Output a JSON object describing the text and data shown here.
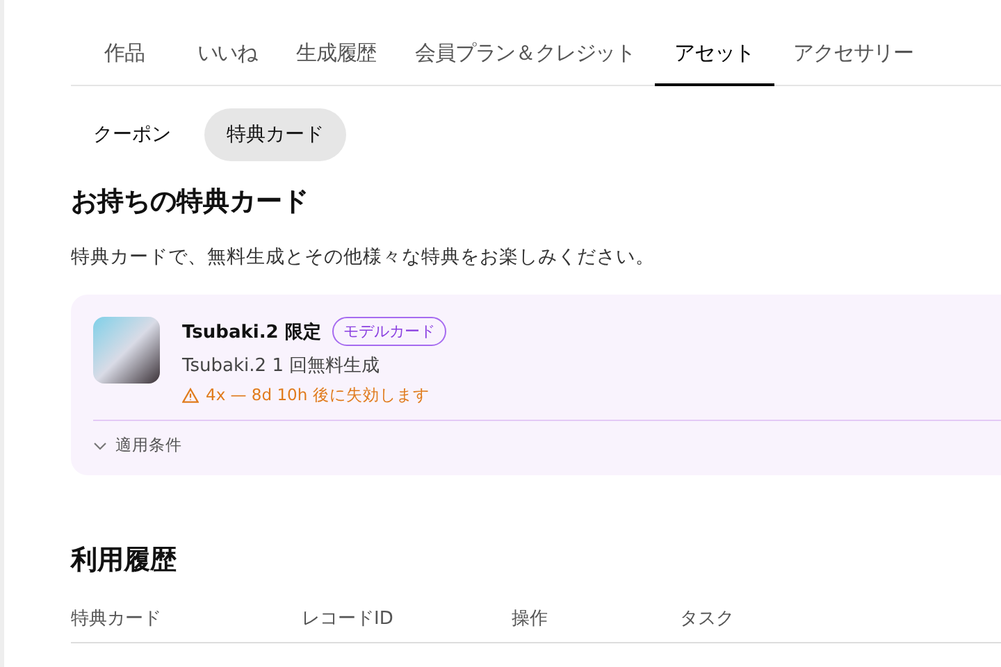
{
  "tabs": [
    {
      "label": "作品",
      "selected": false
    },
    {
      "label": "いいね",
      "selected": false
    },
    {
      "label": "生成履歴",
      "selected": false
    },
    {
      "label": "会員プラン＆クレジット",
      "selected": false
    },
    {
      "label": "アセット",
      "selected": true
    },
    {
      "label": "アクセサリー",
      "selected": false
    }
  ],
  "sub_tabs": [
    {
      "label": "クーポン",
      "selected": false
    },
    {
      "label": "特典カード",
      "selected": true
    }
  ],
  "section_title": "お持ちの特典カード",
  "description": "特典カードで、無料生成とその他様々な特典をお楽しみください。",
  "cards": [
    {
      "title": "Tsubaki.2 限定",
      "badge": "モデルカード",
      "subtitle": "Tsubaki.2 1 回無料生成",
      "warning": "4x — 8d 10h 後に失効します",
      "conditions": "適用条件",
      "expanded": false
    }
  ],
  "history": {
    "title": "利用履歴",
    "columns": [
      "特典カード",
      "レコードID",
      "操作",
      "タスク"
    ]
  }
}
